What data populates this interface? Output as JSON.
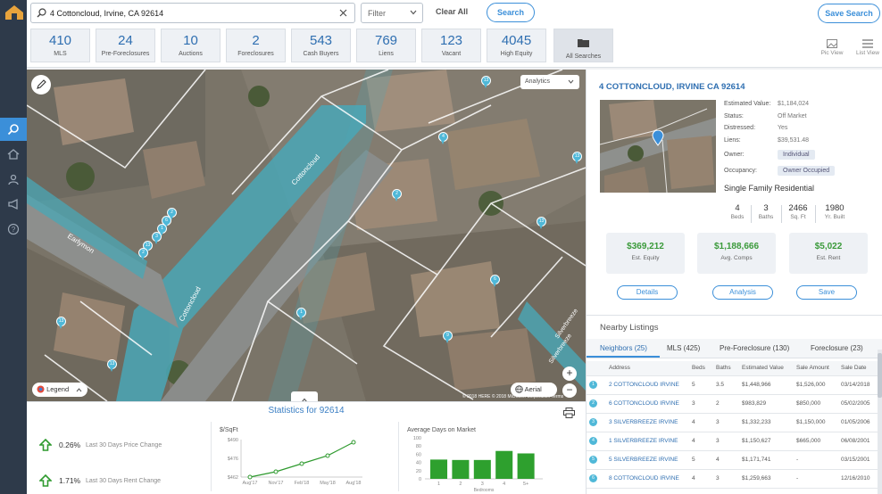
{
  "search": {
    "query": "4 Cottoncloud, Irvine, CA 92614",
    "filter_label": "Filter",
    "clear_label": "Clear All",
    "search_label": "Search",
    "save_search_label": "Save Search"
  },
  "tiles": [
    {
      "value": "410",
      "label": "MLS"
    },
    {
      "value": "24",
      "label": "Pre-Foreclosures"
    },
    {
      "value": "10",
      "label": "Auctions"
    },
    {
      "value": "2",
      "label": "Foreclosures"
    },
    {
      "value": "543",
      "label": "Cash Buyers"
    },
    {
      "value": "769",
      "label": "Liens"
    },
    {
      "value": "123",
      "label": "Vacant"
    },
    {
      "value": "4045",
      "label": "High Equity"
    }
  ],
  "all_searches_label": "All Searches",
  "views": {
    "pic": "Pic View",
    "list": "List View"
  },
  "map": {
    "analytics_label": "Analytics",
    "legend_label": "Legend",
    "aerial_label": "Aerial",
    "copyright": "© 2018 HERE  © 2018 Microsoft Corporation  Terms",
    "streets": [
      "Cottoncloud",
      "Cottoncloud",
      "Earlymon",
      "Silverbreeze",
      "Silverbreeze"
    ],
    "pins": [
      "13",
      "4",
      "13",
      "2",
      "13",
      "1",
      "6",
      "9",
      "13",
      "13",
      "2",
      "6",
      "1",
      "3",
      "13",
      "2"
    ]
  },
  "stats": {
    "title": "Statistics for 92614",
    "price_change": {
      "pct": "0.26%",
      "desc": "Last 30 Days Price Change"
    },
    "rent_change": {
      "pct": "1.71%",
      "desc": "Last 30 Days Rent Change"
    }
  },
  "detail": {
    "address": "4 COTTONCLOUD, IRVINE CA 92614",
    "fields": [
      {
        "key": "Estimated Value:",
        "value": "$1,184,024"
      },
      {
        "key": "Status:",
        "value": "Off Market"
      },
      {
        "key": "Distressed:",
        "value": "Yes"
      },
      {
        "key": "Liens:",
        "value": "$39,531.48"
      }
    ],
    "owner_key": "Owner:",
    "owner_value": "Individual",
    "occupancy_key": "Occupancy:",
    "occupancy_value": "Owner Occupied",
    "property_type": "Single Family Residential",
    "facts": [
      {
        "value": "4",
        "label": "Beds"
      },
      {
        "value": "3",
        "label": "Baths"
      },
      {
        "value": "2466",
        "label": "Sq. Ft"
      },
      {
        "value": "1980",
        "label": "Yr. Built"
      }
    ],
    "money": [
      {
        "value": "$369,212",
        "label": "Est. Equity"
      },
      {
        "value": "$1,188,666",
        "label": "Avg. Comps"
      },
      {
        "value": "$5,022",
        "label": "Est. Rent"
      }
    ],
    "buttons": {
      "details": "Details",
      "analysis": "Analysis",
      "save": "Save"
    }
  },
  "nearby": {
    "title": "Nearby Listings",
    "tabs": [
      "Neighbors (25)",
      "MLS (425)",
      "Pre-Foreclosure (130)",
      "Foreclosure (23)"
    ],
    "columns": [
      "Address",
      "Beds",
      "Baths",
      "Estimated Value",
      "Sale Amount",
      "Sale Date"
    ],
    "rows": [
      {
        "n": "1",
        "address": "2 COTTONCLOUD IRVINE",
        "beds": "5",
        "baths": "3.5",
        "value": "$1,448,966",
        "sale": "$1,526,000",
        "date": "03/14/2018"
      },
      {
        "n": "2",
        "address": "6 COTTONCLOUD IRVINE",
        "beds": "3",
        "baths": "2",
        "value": "$983,829",
        "sale": "$850,000",
        "date": "05/02/2005"
      },
      {
        "n": "3",
        "address": "3 SILVERBREEZE IRVINE",
        "beds": "4",
        "baths": "3",
        "value": "$1,332,233",
        "sale": "$1,150,000",
        "date": "01/05/2006"
      },
      {
        "n": "4",
        "address": "1 SILVERBREEZE IRVINE",
        "beds": "4",
        "baths": "3",
        "value": "$1,150,627",
        "sale": "$665,000",
        "date": "06/08/2001"
      },
      {
        "n": "5",
        "address": "5 SILVERBREEZE IRVINE",
        "beds": "5",
        "baths": "4",
        "value": "$1,171,741",
        "sale": "-",
        "date": "03/15/2001"
      },
      {
        "n": "6",
        "address": "8 COTTONCLOUD IRVINE",
        "beds": "4",
        "baths": "3",
        "value": "$1,259,663",
        "sale": "-",
        "date": "12/16/2010"
      }
    ]
  },
  "chart_data": [
    {
      "type": "line",
      "title": "$/SqFt",
      "x": [
        "Aug'17",
        "Nov'17",
        "Feb'18",
        "May'18",
        "Aug'18"
      ],
      "xticks": [
        "Aug'17",
        "Nov'17",
        "Feb'18",
        "May'18",
        "Aug'18"
      ],
      "y": [
        462,
        466,
        472,
        478,
        488
      ],
      "yticks": [
        "$462",
        "$476",
        "$490"
      ],
      "ylim": [
        462,
        490
      ],
      "color": "#2e9a2e"
    },
    {
      "type": "bar",
      "title": "Average Days on Market",
      "categories": [
        "1",
        "2",
        "3",
        "4",
        "5+"
      ],
      "values": [
        47,
        46,
        46,
        68,
        62
      ],
      "yticks": [
        "0",
        "20",
        "40",
        "60",
        "80",
        "100"
      ],
      "ylim": [
        0,
        100
      ],
      "xlabel": "Bedrooms",
      "color": "#2ea02e"
    }
  ]
}
